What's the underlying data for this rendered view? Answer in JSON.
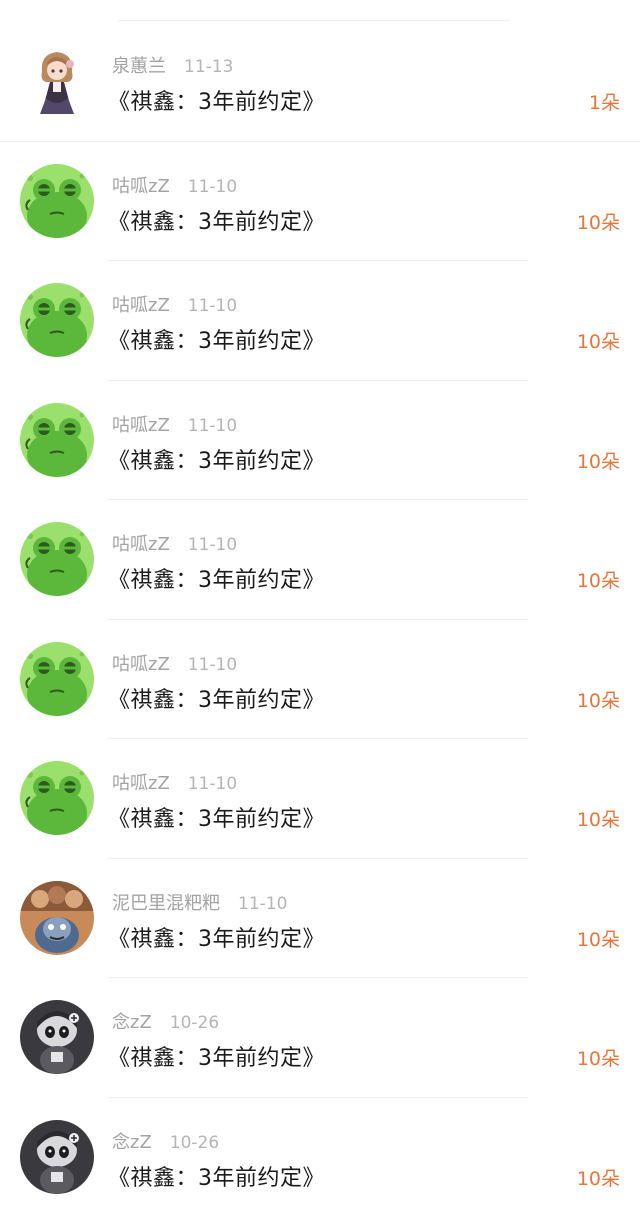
{
  "records": [
    {
      "user": "泉蕙兰",
      "date": "11-13",
      "title": "《祺鑫：3年前约定》",
      "count": "1朵",
      "avatar": "girl-avatar"
    },
    {
      "user": "咕呱zZ",
      "date": "11-10",
      "title": "《祺鑫：3年前约定》",
      "count": "10朵",
      "avatar": "frog-avatar"
    },
    {
      "user": "咕呱zZ",
      "date": "11-10",
      "title": "《祺鑫：3年前约定》",
      "count": "10朵",
      "avatar": "frog-avatar"
    },
    {
      "user": "咕呱zZ",
      "date": "11-10",
      "title": "《祺鑫：3年前约定》",
      "count": "10朵",
      "avatar": "frog-avatar"
    },
    {
      "user": "咕呱zZ",
      "date": "11-10",
      "title": "《祺鑫：3年前约定》",
      "count": "10朵",
      "avatar": "frog-avatar"
    },
    {
      "user": "咕呱zZ",
      "date": "11-10",
      "title": "《祺鑫：3年前约定》",
      "count": "10朵",
      "avatar": "frog-avatar"
    },
    {
      "user": "咕呱zZ",
      "date": "11-10",
      "title": "《祺鑫：3年前约定》",
      "count": "10朵",
      "avatar": "frog-avatar"
    },
    {
      "user": "泥巴里混粑粑",
      "date": "11-10",
      "title": "《祺鑫：3年前约定》",
      "count": "10朵",
      "avatar": "cartoon-cat-avatar"
    },
    {
      "user": "念zZ",
      "date": "10-26",
      "title": "《祺鑫：3年前约定》",
      "count": "10朵",
      "avatar": "robot-avatar"
    },
    {
      "user": "念zZ",
      "date": "10-26",
      "title": "《祺鑫：3年前约定》",
      "count": "10朵",
      "avatar": "robot-avatar"
    }
  ],
  "colors": {
    "accent": "#e8763a",
    "frog_green": "#6ccf3a",
    "meta_gray": "#a3a3a3"
  }
}
